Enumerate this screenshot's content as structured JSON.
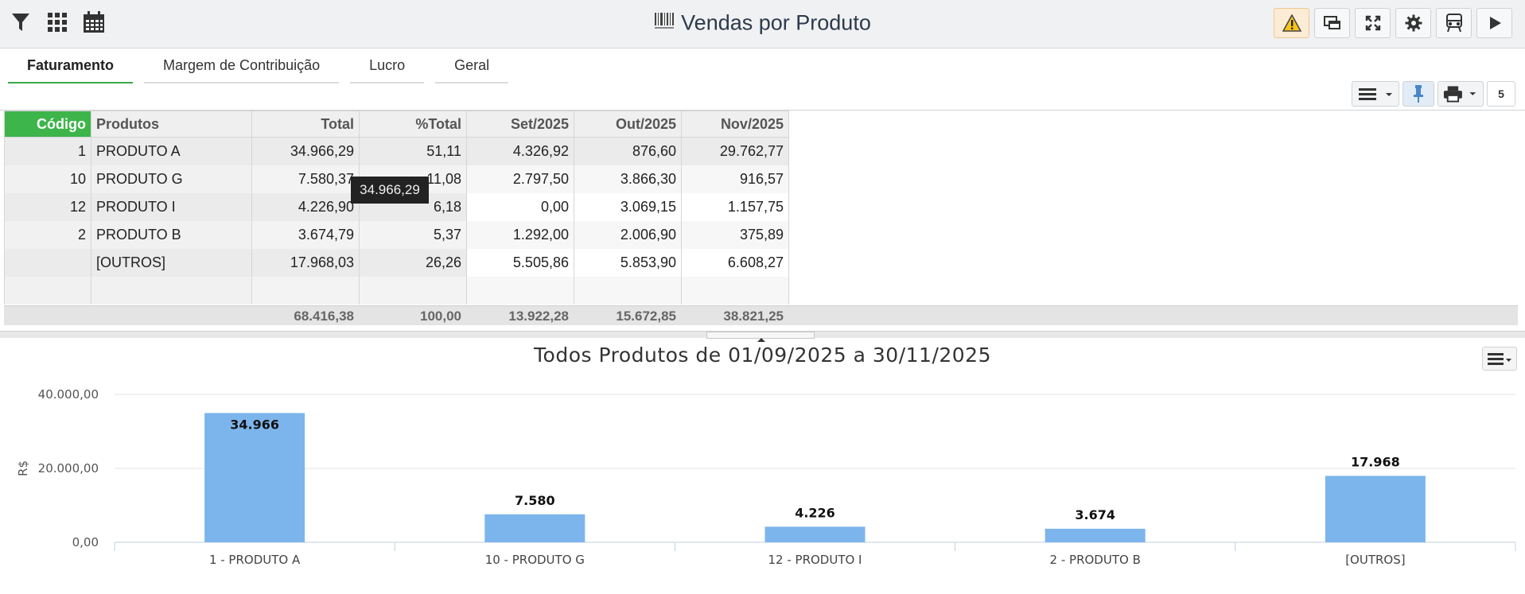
{
  "header": {
    "title": "Vendas por Produto",
    "left_icons": [
      "filter-icon",
      "grid-icon",
      "calendar-icon"
    ],
    "right_buttons": [
      "warning-icon",
      "windows-icon",
      "fullscreen-icon",
      "gear-icon",
      "bus-icon",
      "play-icon"
    ]
  },
  "tabs": [
    {
      "label": "Faturamento",
      "active": true
    },
    {
      "label": "Margem de Contribuição",
      "active": false
    },
    {
      "label": "Lucro",
      "active": false
    },
    {
      "label": "Geral",
      "active": false
    }
  ],
  "grid_tools": {
    "count": "5"
  },
  "table": {
    "columns": [
      "Código",
      "Produtos",
      "Total",
      "%Total",
      "Set/2025",
      "Out/2025",
      "Nov/2025"
    ],
    "rows": [
      [
        "1",
        "PRODUTO A",
        "34.966,29",
        "51,11",
        "4.326,92",
        "876,60",
        "29.762,77"
      ],
      [
        "10",
        "PRODUTO G",
        "7.580,37",
        "11,08",
        "2.797,50",
        "3.866,30",
        "916,57"
      ],
      [
        "12",
        "PRODUTO I",
        "4.226,90",
        "6,18",
        "0,00",
        "3.069,15",
        "1.157,75"
      ],
      [
        "2",
        "PRODUTO B",
        "3.674,79",
        "5,37",
        "1.292,00",
        "2.006,90",
        "375,89"
      ],
      [
        "",
        "[OUTROS]",
        "17.968,03",
        "26,26",
        "5.505,86",
        "5.853,90",
        "6.608,27"
      ]
    ],
    "totals": [
      "68.416,38",
      "100,00",
      "13.922,28",
      "15.672,85",
      "38.821,25"
    ],
    "tooltip": "34.966,29"
  },
  "chart_data": {
    "type": "bar",
    "title": "Todos Produtos de 01/09/2025 a 30/11/2025",
    "ylabel": "R$",
    "xlabel": "",
    "ylim": [
      0,
      40000
    ],
    "yticks": [
      "0,00",
      "20.000,00",
      "40.000,00"
    ],
    "ytick_values": [
      0,
      20000,
      40000
    ],
    "categories": [
      "1 - PRODUTO A",
      "10 - PRODUTO G",
      "12 - PRODUTO I",
      "2 - PRODUTO B",
      "[OUTROS]"
    ],
    "values": [
      34966,
      7580,
      4226,
      3674,
      17968
    ],
    "data_labels": [
      "34.966",
      "7.580",
      "4.226",
      "3.674",
      "17.968"
    ],
    "bar_color": "#7cb5ec",
    "grid": true,
    "legend": "none"
  },
  "colors": {
    "accent": "#3db54a",
    "warning": "#f5c518"
  }
}
